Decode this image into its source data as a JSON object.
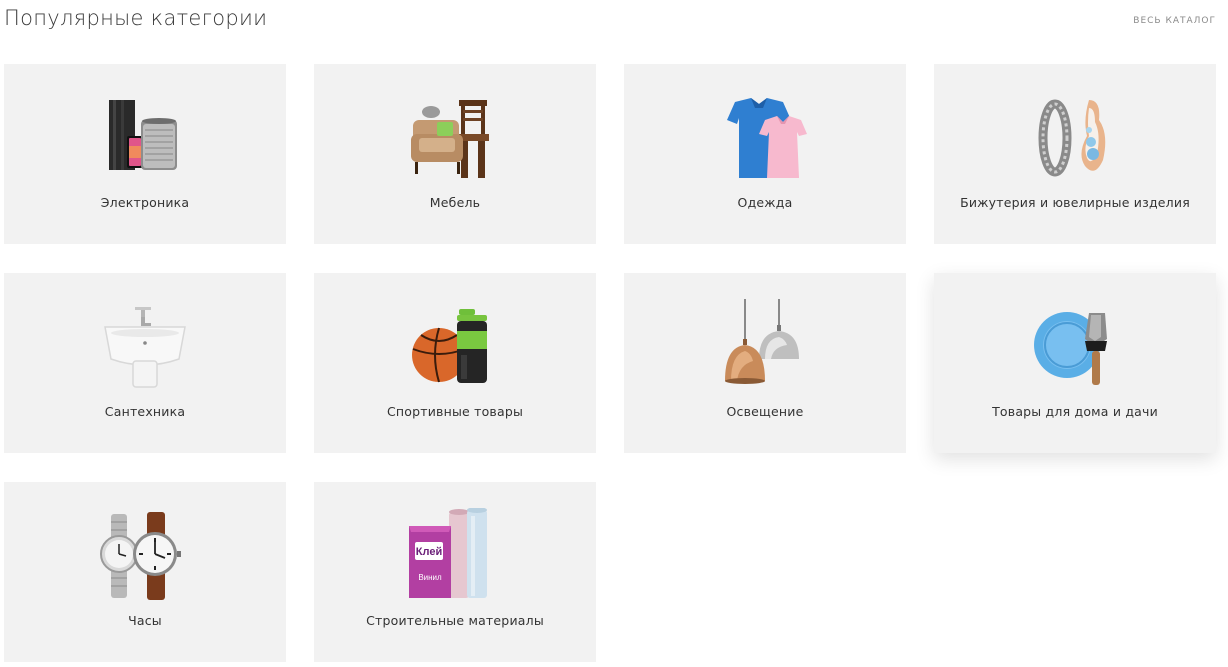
{
  "header": {
    "title": "Популярные категории",
    "catalog_link": "ВЕСЬ КАТАЛОГ"
  },
  "categories": [
    {
      "label": "Электроника",
      "icon": "electronics-icon"
    },
    {
      "label": "Мебель",
      "icon": "furniture-icon"
    },
    {
      "label": "Одежда",
      "icon": "clothing-icon"
    },
    {
      "label": "Бижутерия и ювелирные изделия",
      "icon": "jewelry-icon"
    },
    {
      "label": "Сантехника",
      "icon": "sink-icon"
    },
    {
      "label": "Спортивные товары",
      "icon": "sports-icon"
    },
    {
      "label": "Освещение",
      "icon": "lamp-icon"
    },
    {
      "label": "Товары для дома и дачи",
      "icon": "home-garden-icon"
    },
    {
      "label": "Часы",
      "icon": "watches-icon"
    },
    {
      "label": "Строительные материалы",
      "icon": "building-materials-icon"
    }
  ],
  "package_labels": {
    "glue": "Клей",
    "vinyl": "Винил"
  }
}
